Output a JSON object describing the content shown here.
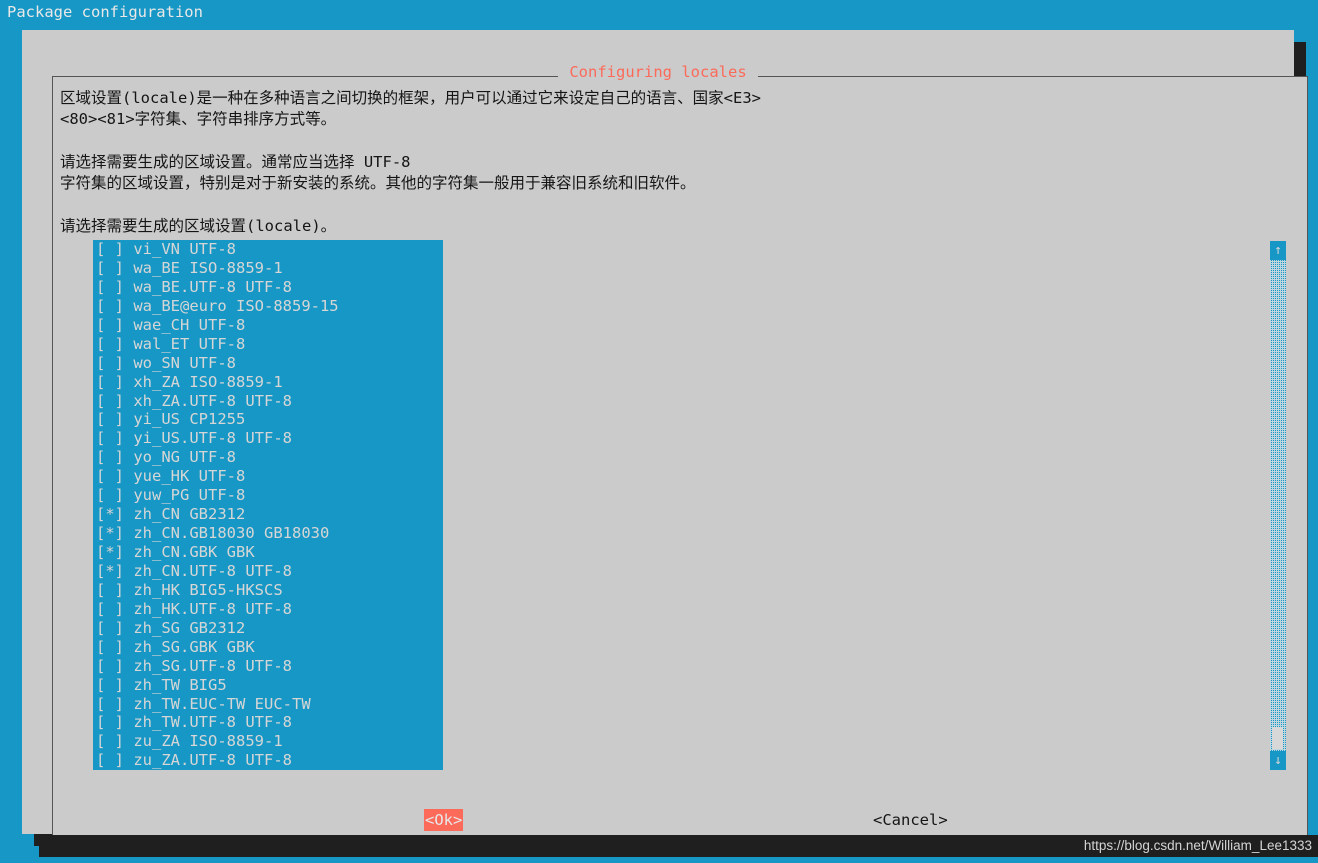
{
  "screen": {
    "title": "Package configuration",
    "background_color": "#1797c5"
  },
  "dialog": {
    "title": "Configuring locales",
    "title_color": "#fc6a5a",
    "background_color": "#cbcbcb",
    "body_lines": [
      "区域设置(locale)是一种在多种语言之间切换的框架，用户可以通过它来设定自己的语言、国家<E3>",
      "<80><81>字符集、字符串排序方式等。",
      "",
      "请选择需要生成的区域设置。通常应当选择 UTF-8",
      "字符集的区域设置，特别是对于新安装的系统。其他的字符集一般用于兼容旧系统和旧软件。",
      "",
      "请选择需要生成的区域设置(locale)。"
    ]
  },
  "listbox": {
    "background_color": "#1797c5",
    "text_color": "#d6d6d6",
    "items": [
      {
        "checked": false,
        "mark": "[ ]",
        "label": "vi_VN UTF-8"
      },
      {
        "checked": false,
        "mark": "[ ]",
        "label": "wa_BE ISO-8859-1"
      },
      {
        "checked": false,
        "mark": "[ ]",
        "label": "wa_BE.UTF-8 UTF-8"
      },
      {
        "checked": false,
        "mark": "[ ]",
        "label": "wa_BE@euro ISO-8859-15"
      },
      {
        "checked": false,
        "mark": "[ ]",
        "label": "wae_CH UTF-8"
      },
      {
        "checked": false,
        "mark": "[ ]",
        "label": "wal_ET UTF-8"
      },
      {
        "checked": false,
        "mark": "[ ]",
        "label": "wo_SN UTF-8"
      },
      {
        "checked": false,
        "mark": "[ ]",
        "label": "xh_ZA ISO-8859-1"
      },
      {
        "checked": false,
        "mark": "[ ]",
        "label": "xh_ZA.UTF-8 UTF-8"
      },
      {
        "checked": false,
        "mark": "[ ]",
        "label": "yi_US CP1255"
      },
      {
        "checked": false,
        "mark": "[ ]",
        "label": "yi_US.UTF-8 UTF-8"
      },
      {
        "checked": false,
        "mark": "[ ]",
        "label": "yo_NG UTF-8"
      },
      {
        "checked": false,
        "mark": "[ ]",
        "label": "yue_HK UTF-8"
      },
      {
        "checked": false,
        "mark": "[ ]",
        "label": "yuw_PG UTF-8"
      },
      {
        "checked": true,
        "mark": "[*]",
        "label": "zh_CN GB2312"
      },
      {
        "checked": true,
        "mark": "[*]",
        "label": "zh_CN.GB18030 GB18030"
      },
      {
        "checked": true,
        "mark": "[*]",
        "label": "zh_CN.GBK GBK"
      },
      {
        "checked": true,
        "mark": "[*]",
        "label": "zh_CN.UTF-8 UTF-8"
      },
      {
        "checked": false,
        "mark": "[ ]",
        "label": "zh_HK BIG5-HKSCS"
      },
      {
        "checked": false,
        "mark": "[ ]",
        "label": "zh_HK.UTF-8 UTF-8"
      },
      {
        "checked": false,
        "mark": "[ ]",
        "label": "zh_SG GB2312"
      },
      {
        "checked": false,
        "mark": "[ ]",
        "label": "zh_SG.GBK GBK"
      },
      {
        "checked": false,
        "mark": "[ ]",
        "label": "zh_SG.UTF-8 UTF-8"
      },
      {
        "checked": false,
        "mark": "[ ]",
        "label": "zh_TW BIG5"
      },
      {
        "checked": false,
        "mark": "[ ]",
        "label": "zh_TW.EUC-TW EUC-TW"
      },
      {
        "checked": false,
        "mark": "[ ]",
        "label": "zh_TW.UTF-8 UTF-8"
      },
      {
        "checked": false,
        "mark": "[ ]",
        "label": "zu_ZA ISO-8859-1"
      },
      {
        "checked": false,
        "mark": "[ ]",
        "label": "zu_ZA.UTF-8 UTF-8"
      }
    ]
  },
  "scrollbar": {
    "up_glyph": "↑",
    "down_glyph": "↓",
    "position": "bottom"
  },
  "buttons": {
    "ok": "<Ok>",
    "cancel": "<Cancel>",
    "ok_selected": true,
    "ok_highlight_color": "#fc6a5a"
  },
  "watermark": {
    "text": "https://blog.csdn.net/William_Lee1333"
  }
}
